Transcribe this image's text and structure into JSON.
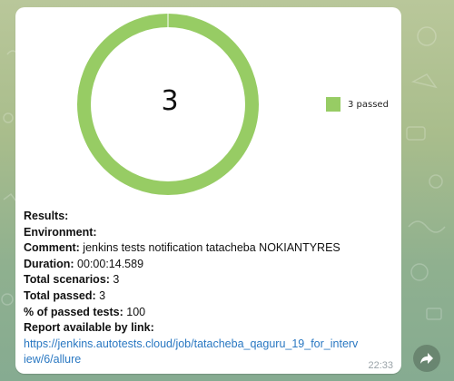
{
  "chart_data": {
    "type": "pie",
    "center_label": "3",
    "slices": [
      {
        "name": "3 passed",
        "value": 3,
        "color": "#97cc64"
      }
    ]
  },
  "message": {
    "lines": [
      {
        "label": "Results:",
        "value": ""
      },
      {
        "label": "Environment:",
        "value": ""
      },
      {
        "label": "Comment:",
        "value": "jenkins tests notification tatacheba NOKIANTYRES"
      },
      {
        "label": "Duration:",
        "value": "00:00:14.589"
      },
      {
        "label": "Total scenarios:",
        "value": "3"
      },
      {
        "label": "Total passed:",
        "value": "3"
      },
      {
        "label": "% of passed tests:",
        "value": "100"
      },
      {
        "label": "Report available by link:",
        "value": ""
      }
    ],
    "link": "https://jenkins.autotests.cloud/job/tatacheba_qaguru_19_for_interview/6/allure",
    "time": "22:33"
  },
  "colors": {
    "passed": "#97cc64",
    "link": "#2a78c2",
    "bubble": "#ffffff"
  },
  "icons": {
    "forward": "forward-arrow-icon"
  }
}
